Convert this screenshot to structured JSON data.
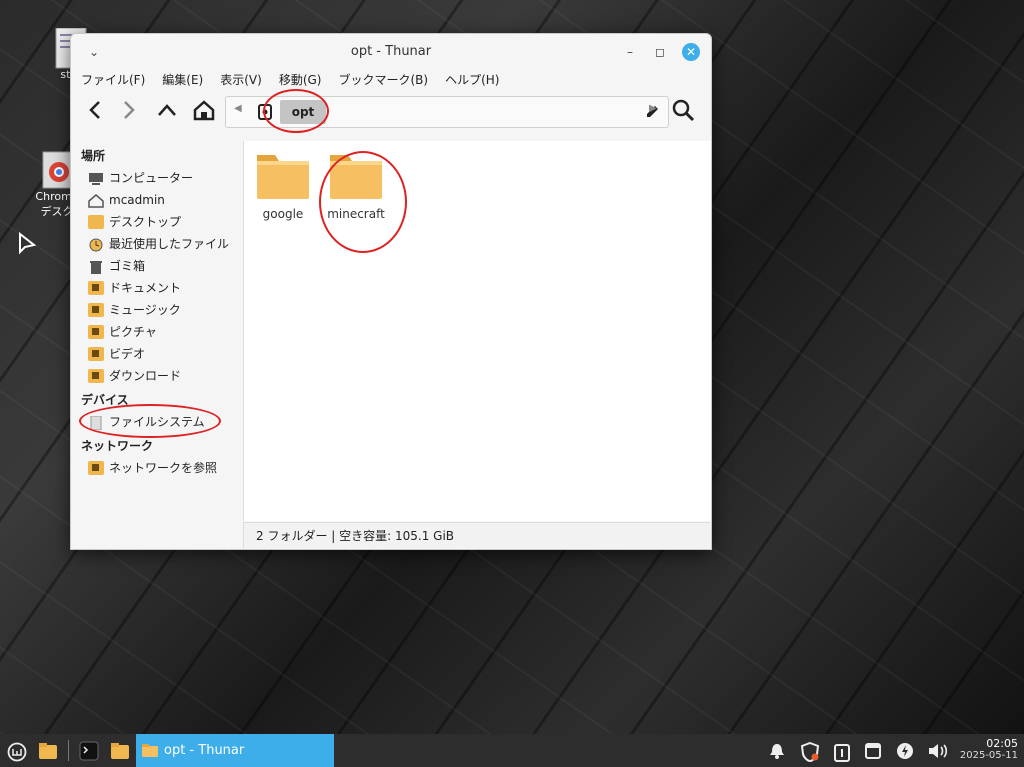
{
  "desktop": {
    "icons": [
      {
        "label": "star"
      },
      {
        "label": "Chrome",
        "label2": "デスク"
      }
    ]
  },
  "window": {
    "title": "opt - Thunar",
    "menu": [
      "ファイル(F)",
      "編集(E)",
      "表示(V)",
      "移動(G)",
      "ブックマーク(B)",
      "ヘルプ(H)"
    ],
    "location": {
      "crumb": "opt"
    },
    "sidebar": {
      "places_header": "場所",
      "places": [
        {
          "label": "コンピューター",
          "icon": "computer-icon"
        },
        {
          "label": "mcadmin",
          "icon": "home-icon"
        },
        {
          "label": "デスクトップ",
          "icon": "desktop-folder-icon"
        },
        {
          "label": "最近使用したファイル",
          "icon": "recent-icon"
        },
        {
          "label": "ゴミ箱",
          "icon": "trash-icon"
        },
        {
          "label": "ドキュメント",
          "icon": "documents-folder-icon"
        },
        {
          "label": "ミュージック",
          "icon": "music-folder-icon"
        },
        {
          "label": "ピクチャ",
          "icon": "pictures-folder-icon"
        },
        {
          "label": "ビデオ",
          "icon": "videos-folder-icon"
        },
        {
          "label": "ダウンロード",
          "icon": "downloads-folder-icon"
        }
      ],
      "devices_header": "デバイス",
      "devices": [
        {
          "label": "ファイルシステム",
          "icon": "drive-icon"
        }
      ],
      "network_header": "ネットワーク",
      "network": [
        {
          "label": "ネットワークを参照",
          "icon": "network-folder-icon"
        }
      ]
    },
    "folders": [
      {
        "name": "google"
      },
      {
        "name": "minecraft"
      }
    ],
    "status": "2 フォルダー  |  空き容量: 105.1 GiB"
  },
  "panel": {
    "task_label": "opt - Thunar",
    "time": "02:05",
    "date": "2025-05-11"
  },
  "colors": {
    "accent": "#3daee9",
    "folder": "#f0b74f",
    "annotation": "#dd2222"
  }
}
